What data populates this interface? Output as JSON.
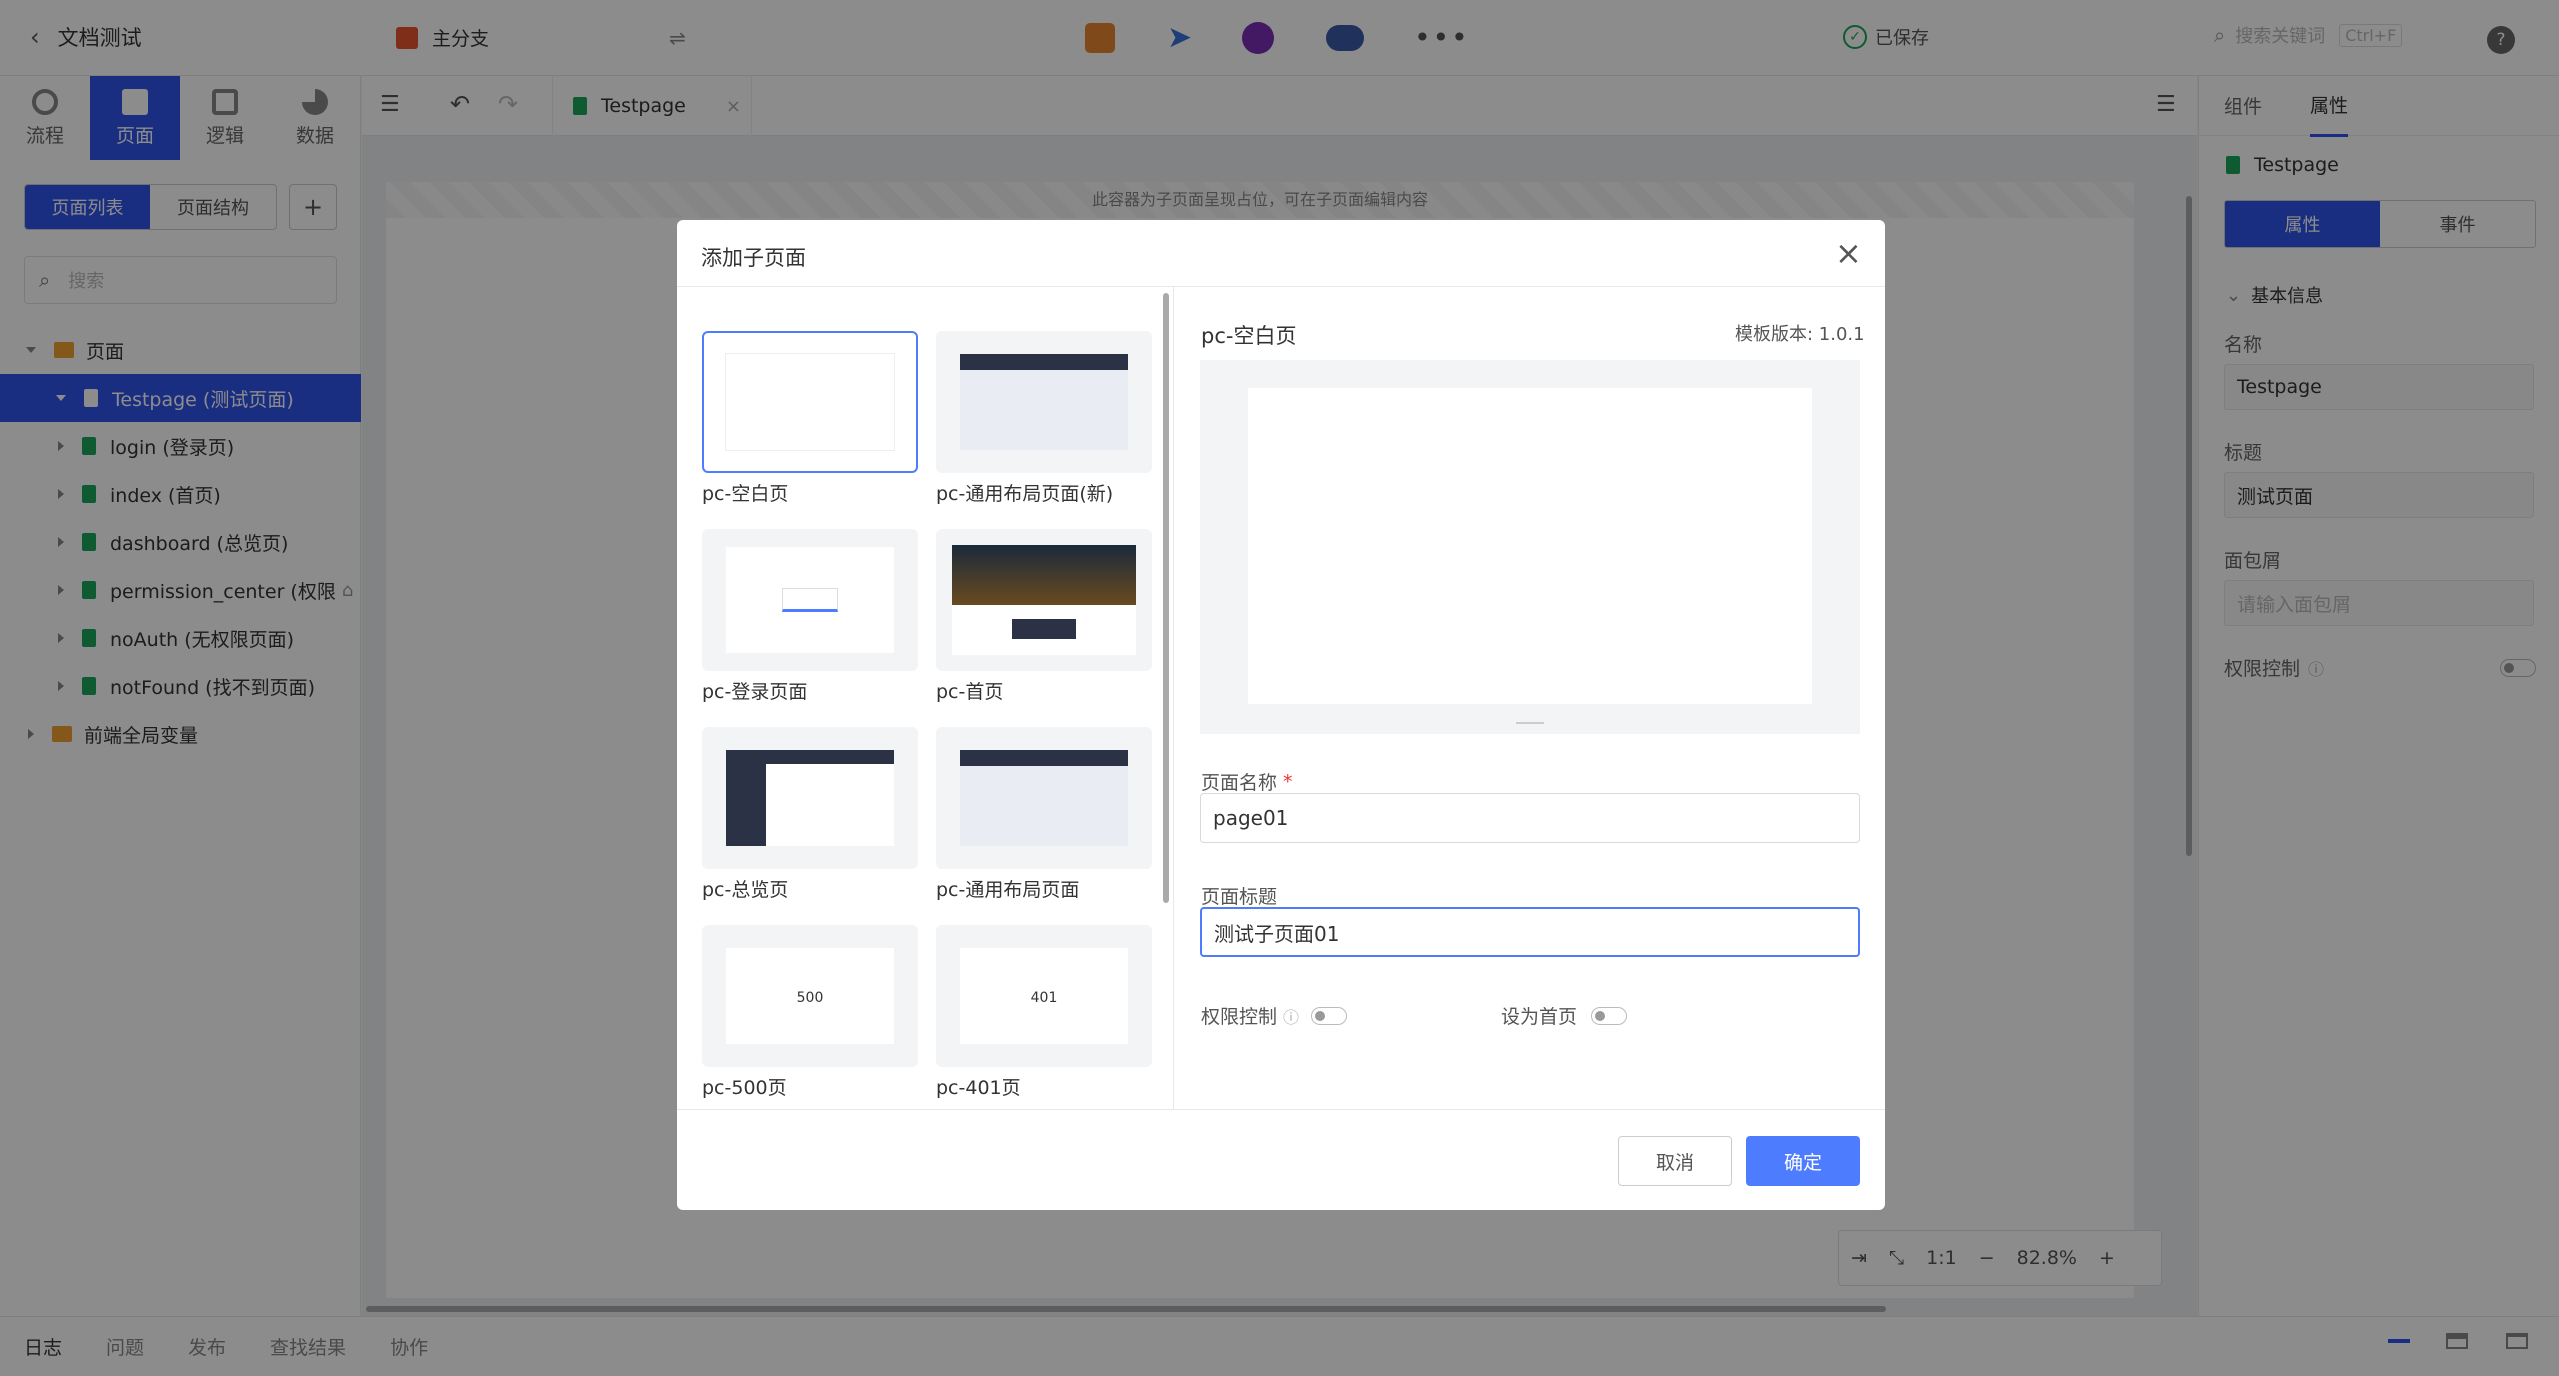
{
  "topbar": {
    "back_label": "文档测试",
    "branch_label": "主分支",
    "saved_label": "已保存",
    "search_placeholder": "搜索关键词",
    "shortcut": "Ctrl+F",
    "help": "?"
  },
  "leftnav": {
    "tabs": [
      "流程",
      "页面",
      "逻辑",
      "数据"
    ],
    "active_tab": "页面",
    "subtabs": [
      "页面列表",
      "页面结构"
    ],
    "add": "+",
    "search_placeholder": "搜索",
    "tree": {
      "root": "页面",
      "items": [
        "Testpage (测试页面)",
        "login (登录页)",
        "index (首页)",
        "dashboard (总览页)",
        "permission_center (权限",
        "noAuth (无权限页面)",
        "notFound (找不到页面)"
      ],
      "global": "前端全局变量"
    }
  },
  "editor": {
    "tab_label": "Testpage",
    "canvas_hint": "此容器为子页面呈现占位，可在子页面编辑内容",
    "zoom_ratio": "1:1",
    "zoom": "82.8%",
    "zoom_minus": "−",
    "zoom_plus": "+"
  },
  "rightpanel": {
    "tabs": [
      "组件",
      "属性"
    ],
    "page_name": "Testpage",
    "subtabs": [
      "属性",
      "事件"
    ],
    "section": "基本信息",
    "name_label": "名称",
    "name_value": "Testpage",
    "title_label": "标题",
    "title_value": "测试页面",
    "breadcrumb_label": "面包屑",
    "breadcrumb_placeholder": "请输入面包屑",
    "permission_label": "权限控制"
  },
  "bottombar": {
    "tabs": [
      "日志",
      "问题",
      "发布",
      "查找结果",
      "协作"
    ]
  },
  "modal": {
    "title": "添加子页面",
    "templates": [
      "pc-空白页",
      "pc-通用布局页面(新)",
      "pc-登录页面",
      "pc-首页",
      "pc-总览页",
      "pc-通用布局页面",
      "pc-500页",
      "pc-401页"
    ],
    "preview_title": "pc-空白页",
    "version": "模板版本: 1.0.1",
    "page_name_label": "页面名称",
    "required_mark": "*",
    "page_name_value": "page01",
    "page_title_label": "页面标题",
    "page_title_value": "测试子页面01",
    "permission_label": "权限控制",
    "homepage_label": "设为首页",
    "cancel": "取消",
    "confirm": "确定",
    "thumb_500": "500",
    "thumb_401": "401"
  },
  "colors": {
    "accent": "#4d7cfe",
    "active_nav": "#2f54eb",
    "file_icon": "#1aa65a",
    "folder_icon": "#f0a032"
  }
}
